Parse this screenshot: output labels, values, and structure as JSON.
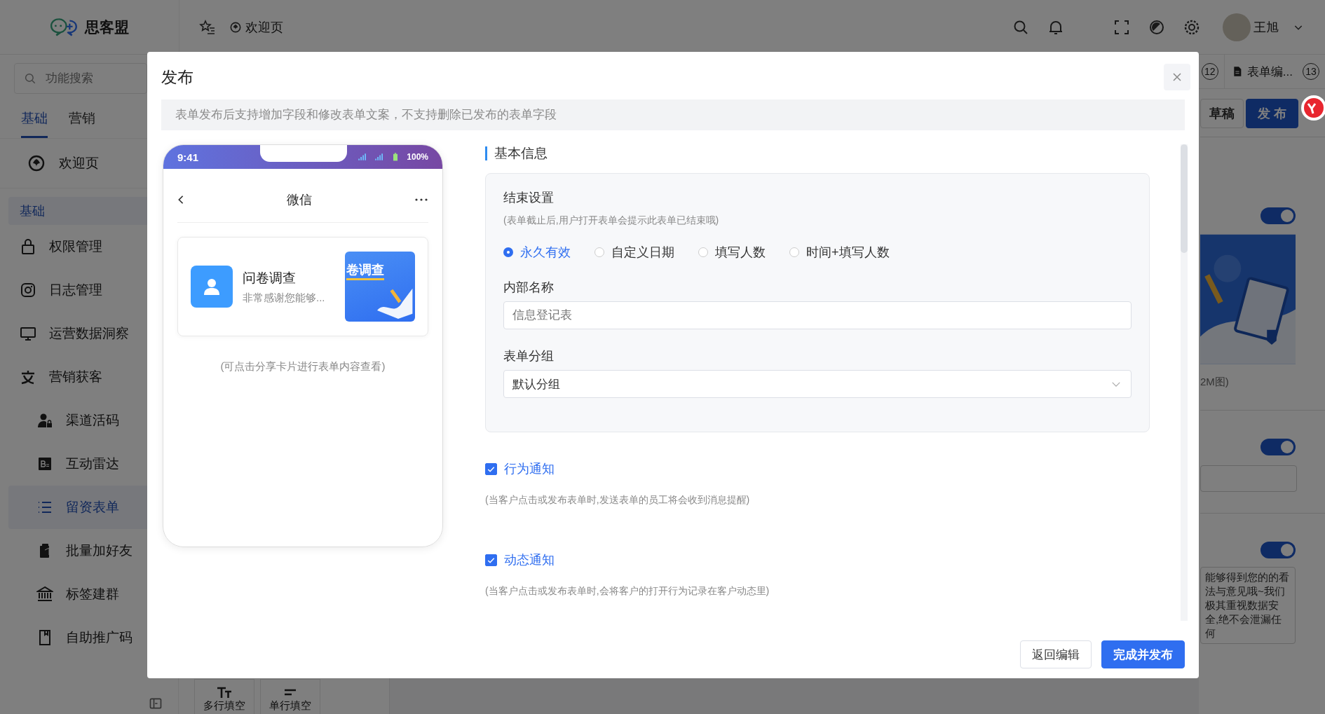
{
  "header": {
    "logo": "思客盟",
    "breadcrumb": "欢迎页",
    "user": "王旭"
  },
  "sidebar": {
    "search_placeholder": "功能搜索",
    "tabs": [
      {
        "label": "基础",
        "selected": true
      },
      {
        "label": "营销",
        "selected": false
      }
    ],
    "home": "欢迎页",
    "group": "基础",
    "items": [
      {
        "label": "权限管理",
        "selected": false
      },
      {
        "label": "日志管理",
        "selected": false
      },
      {
        "label": "运营数据洞察",
        "selected": false
      },
      {
        "label": "营销获客",
        "selected": false,
        "children": [
          {
            "label": "渠道活码",
            "selected": false
          },
          {
            "label": "互动雷达",
            "selected": false
          },
          {
            "label": "留资表单",
            "selected": true
          },
          {
            "label": "批量加好友",
            "selected": false
          },
          {
            "label": "标签建群",
            "selected": false
          },
          {
            "label": "自助推广码",
            "selected": false
          }
        ]
      }
    ]
  },
  "page_tabs": [
    {
      "badge": "12"
    },
    {
      "label": "表单编...",
      "badge": "13"
    }
  ],
  "editor_actions": [
    "草稿",
    "发 布"
  ],
  "editor_panel": {
    "toggles": [
      {
        "on": true
      },
      {
        "on": true
      },
      {
        "on": true
      }
    ],
    "image_hint": "2M图)",
    "intro_text": "能够得到您的的看法与意见哦~我们极其重视数据安全,绝不会泄漏任何"
  },
  "field_types": [
    {
      "label": "多行填空"
    },
    {
      "label": "单行填空"
    }
  ],
  "dialog": {
    "title": "发布",
    "notice": "表单发布后支持增加字段和修改表单文案，不支持删除已发布的表单字段",
    "preview": {
      "time": "9:41",
      "battery": "100%",
      "nav_title": "微信",
      "card_title": "问卷调查",
      "card_desc": "非常感谢您能够...",
      "thumb_text": "卷调查",
      "hint": "(可点击分享卡片进行表单内容查看)"
    },
    "section_title": "基本信息",
    "end_settings": {
      "label": "结束设置",
      "hint": "(表单截止后,用户打开表单会提示此表单已结束哦)",
      "options": [
        {
          "label": "永久有效",
          "selected": true
        },
        {
          "label": "自定义日期",
          "selected": false
        },
        {
          "label": "填写人数",
          "selected": false
        },
        {
          "label": "时间+填写人数",
          "selected": false
        }
      ]
    },
    "internal_name": {
      "label": "内部名称",
      "placeholder": "信息登记表"
    },
    "group": {
      "label": "表单分组",
      "value": "默认分组"
    },
    "notifications": [
      {
        "label": "行为通知",
        "checked": true,
        "hint": "(当客户点击或发布表单时,发送表单的员工将会收到消息提醒)"
      },
      {
        "label": "动态通知",
        "checked": true,
        "hint": "(当客户点击或发布表单时,会将客户的打开行为记录在客户动态里)"
      }
    ],
    "buttons": [
      {
        "label": "返回编辑",
        "kind": "secondary"
      },
      {
        "label": "完成并发布",
        "kind": "primary"
      }
    ]
  }
}
